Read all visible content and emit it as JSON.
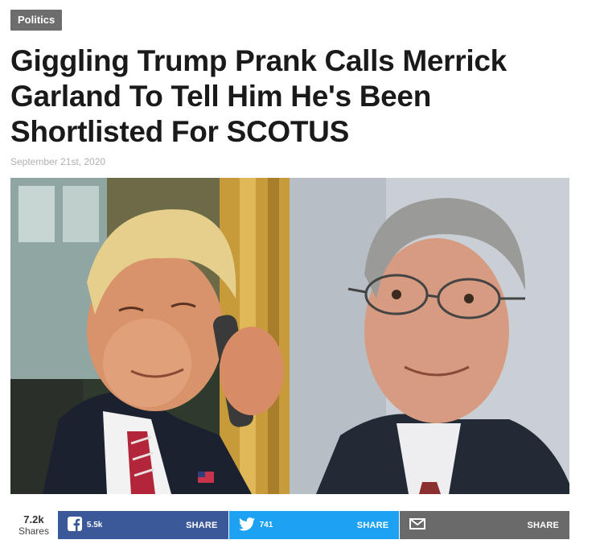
{
  "category": "Politics",
  "headline": "Giggling Trump Prank Calls Merrick Garland To Tell Him He's Been Shortlisted For SCOTUS",
  "date": "September 21st, 2020",
  "image": {
    "icon": "photo-trump-garland"
  },
  "share": {
    "total_count": "7.2k",
    "total_label": "Shares",
    "facebook": {
      "icon": "facebook-icon",
      "count": "5.5k",
      "label": "SHARE",
      "color": "#3b5998"
    },
    "twitter": {
      "icon": "twitter-icon",
      "count": "741",
      "label": "SHARE",
      "color": "#1da1f2"
    },
    "email": {
      "icon": "email-icon",
      "label": "SHARE",
      "color": "#6a6a6a"
    }
  }
}
